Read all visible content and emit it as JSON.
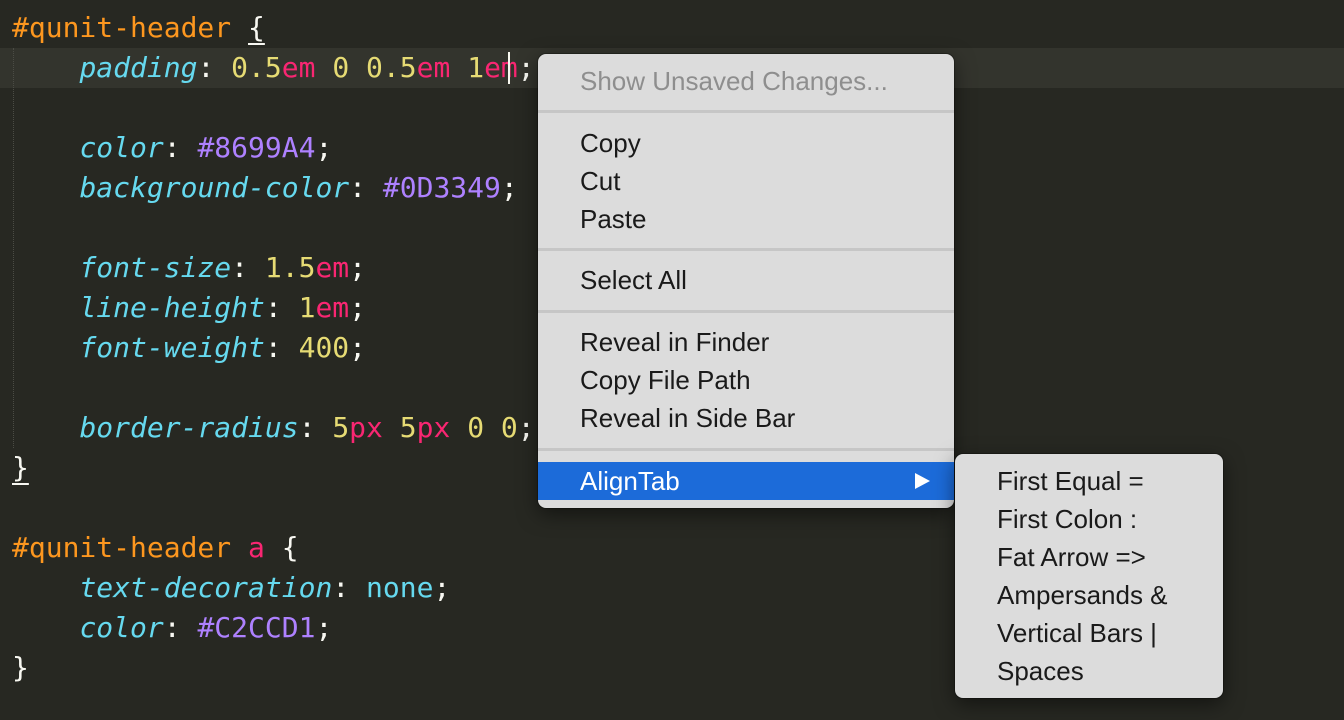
{
  "editor": {
    "lines": [
      {
        "segments": [
          {
            "t": "#qunit-header ",
            "c": "sel"
          },
          {
            "t": "{",
            "c": "punct brace-ul"
          }
        ]
      },
      {
        "segments": [
          {
            "t": "    ",
            "c": "punct"
          },
          {
            "t": "padding",
            "c": "prop"
          },
          {
            "t": ": ",
            "c": "punct"
          },
          {
            "t": "0.5",
            "c": "num"
          },
          {
            "t": "em",
            "c": "unit"
          },
          {
            "t": " ",
            "c": "punct"
          },
          {
            "t": "0",
            "c": "num"
          },
          {
            "t": " ",
            "c": "punct"
          },
          {
            "t": "0.5",
            "c": "num"
          },
          {
            "t": "em",
            "c": "unit"
          },
          {
            "t": " ",
            "c": "punct"
          },
          {
            "t": "1",
            "c": "num"
          },
          {
            "t": "em",
            "c": "unit"
          },
          {
            "t": ";",
            "c": "punct"
          }
        ]
      },
      {
        "segments": []
      },
      {
        "segments": [
          {
            "t": "    ",
            "c": "punct"
          },
          {
            "t": "color",
            "c": "prop"
          },
          {
            "t": ": ",
            "c": "punct"
          },
          {
            "t": "#8699A4",
            "c": "hex"
          },
          {
            "t": ";",
            "c": "punct"
          }
        ]
      },
      {
        "segments": [
          {
            "t": "    ",
            "c": "punct"
          },
          {
            "t": "background-color",
            "c": "prop"
          },
          {
            "t": ": ",
            "c": "punct"
          },
          {
            "t": "#0D3349",
            "c": "hex"
          },
          {
            "t": ";",
            "c": "punct"
          }
        ]
      },
      {
        "segments": []
      },
      {
        "segments": [
          {
            "t": "    ",
            "c": "punct"
          },
          {
            "t": "font-size",
            "c": "prop"
          },
          {
            "t": ": ",
            "c": "punct"
          },
          {
            "t": "1.5",
            "c": "num"
          },
          {
            "t": "em",
            "c": "unit"
          },
          {
            "t": ";",
            "c": "punct"
          }
        ]
      },
      {
        "segments": [
          {
            "t": "    ",
            "c": "punct"
          },
          {
            "t": "line-height",
            "c": "prop"
          },
          {
            "t": ": ",
            "c": "punct"
          },
          {
            "t": "1",
            "c": "num"
          },
          {
            "t": "em",
            "c": "unit"
          },
          {
            "t": ";",
            "c": "punct"
          }
        ]
      },
      {
        "segments": [
          {
            "t": "    ",
            "c": "punct"
          },
          {
            "t": "font-weight",
            "c": "prop"
          },
          {
            "t": ": ",
            "c": "punct"
          },
          {
            "t": "400",
            "c": "num"
          },
          {
            "t": ";",
            "c": "punct"
          }
        ]
      },
      {
        "segments": []
      },
      {
        "segments": [
          {
            "t": "    ",
            "c": "punct"
          },
          {
            "t": "border-radius",
            "c": "prop"
          },
          {
            "t": ": ",
            "c": "punct"
          },
          {
            "t": "5",
            "c": "num"
          },
          {
            "t": "px",
            "c": "unit"
          },
          {
            "t": " ",
            "c": "punct"
          },
          {
            "t": "5",
            "c": "num"
          },
          {
            "t": "px",
            "c": "unit"
          },
          {
            "t": " ",
            "c": "punct"
          },
          {
            "t": "0",
            "c": "num"
          },
          {
            "t": " ",
            "c": "punct"
          },
          {
            "t": "0",
            "c": "num"
          },
          {
            "t": ";",
            "c": "punct"
          }
        ]
      },
      {
        "segments": [
          {
            "t": "}",
            "c": "punct brace-ul"
          }
        ]
      },
      {
        "segments": []
      },
      {
        "segments": [
          {
            "t": "#qunit-header ",
            "c": "sel"
          },
          {
            "t": "a",
            "c": "el"
          },
          {
            "t": " {",
            "c": "punct"
          }
        ]
      },
      {
        "segments": [
          {
            "t": "    ",
            "c": "punct"
          },
          {
            "t": "text-decoration",
            "c": "prop"
          },
          {
            "t": ": ",
            "c": "punct"
          },
          {
            "t": "none",
            "c": "kw"
          },
          {
            "t": ";",
            "c": "punct"
          }
        ]
      },
      {
        "segments": [
          {
            "t": "    ",
            "c": "punct"
          },
          {
            "t": "color",
            "c": "prop"
          },
          {
            "t": ": ",
            "c": "punct"
          },
          {
            "t": "#C2CCD1",
            "c": "hex"
          },
          {
            "t": ";",
            "c": "punct"
          }
        ]
      },
      {
        "segments": [
          {
            "t": "}",
            "c": "punct"
          }
        ]
      }
    ]
  },
  "context_menu": {
    "show_unsaved_changes": "Show Unsaved Changes...",
    "copy": "Copy",
    "cut": "Cut",
    "paste": "Paste",
    "select_all": "Select All",
    "reveal_in_finder": "Reveal in Finder",
    "copy_file_path": "Copy File Path",
    "reveal_in_side_bar": "Reveal in Side Bar",
    "aligntab": "AlignTab"
  },
  "submenu": {
    "items": [
      "First Equal =",
      "First Colon :",
      "Fat Arrow =>",
      "Ampersands &",
      "Vertical Bars |",
      "Spaces"
    ]
  },
  "colors": {
    "editor_bg": "#272822",
    "menu_bg": "#dcdcdc",
    "highlight": "#1c6bd9"
  }
}
